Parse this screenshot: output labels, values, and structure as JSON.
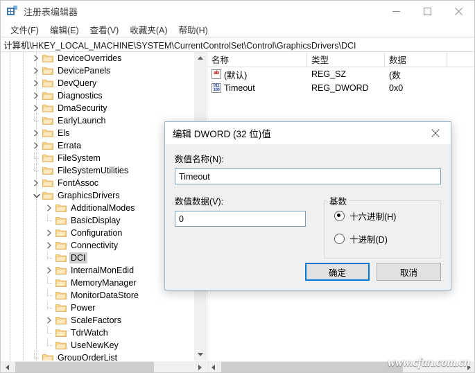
{
  "window": {
    "title": "注册表编辑器",
    "icon": "registry-editor-icon",
    "minimize_label": "最小化",
    "maximize_label": "最大化",
    "close_label": "关闭"
  },
  "menubar": {
    "items": [
      {
        "label": "文件(F)",
        "name": "menu-file"
      },
      {
        "label": "编辑(E)",
        "name": "menu-edit"
      },
      {
        "label": "查看(V)",
        "name": "menu-view"
      },
      {
        "label": "收藏夹(A)",
        "name": "menu-favorites"
      },
      {
        "label": "帮助(H)",
        "name": "menu-help"
      }
    ]
  },
  "address": {
    "path": "计算机\\HKEY_LOCAL_MACHINE\\SYSTEM\\CurrentControlSet\\Control\\GraphicsDrivers\\DCI"
  },
  "tree": {
    "nodes": [
      {
        "label": "DeviceOverrides",
        "indent": 3,
        "expander": "collapsed",
        "selected": false
      },
      {
        "label": "DevicePanels",
        "indent": 3,
        "expander": "collapsed",
        "selected": false
      },
      {
        "label": "DevQuery",
        "indent": 3,
        "expander": "collapsed",
        "selected": false
      },
      {
        "label": "Diagnostics",
        "indent": 3,
        "expander": "collapsed",
        "selected": false
      },
      {
        "label": "DmaSecurity",
        "indent": 3,
        "expander": "collapsed",
        "selected": false
      },
      {
        "label": "EarlyLaunch",
        "indent": 3,
        "expander": "leaf",
        "selected": false
      },
      {
        "label": "Els",
        "indent": 3,
        "expander": "collapsed",
        "selected": false
      },
      {
        "label": "Errata",
        "indent": 3,
        "expander": "collapsed",
        "selected": false
      },
      {
        "label": "FileSystem",
        "indent": 3,
        "expander": "leaf",
        "selected": false
      },
      {
        "label": "FileSystemUtilities",
        "indent": 3,
        "expander": "leaf",
        "selected": false
      },
      {
        "label": "FontAssoc",
        "indent": 3,
        "expander": "collapsed",
        "selected": false
      },
      {
        "label": "GraphicsDrivers",
        "indent": 3,
        "expander": "expanded",
        "selected": false
      },
      {
        "label": "AdditionalModes",
        "indent": 4,
        "expander": "collapsed",
        "selected": false
      },
      {
        "label": "BasicDisplay",
        "indent": 4,
        "expander": "leaf",
        "selected": false
      },
      {
        "label": "Configuration",
        "indent": 4,
        "expander": "collapsed",
        "selected": false
      },
      {
        "label": "Connectivity",
        "indent": 4,
        "expander": "collapsed",
        "selected": false
      },
      {
        "label": "DCI",
        "indent": 4,
        "expander": "leaf",
        "selected": true
      },
      {
        "label": "InternalMonEdid",
        "indent": 4,
        "expander": "collapsed",
        "selected": false
      },
      {
        "label": "MemoryManager",
        "indent": 4,
        "expander": "leaf",
        "selected": false
      },
      {
        "label": "MonitorDataStore",
        "indent": 4,
        "expander": "leaf",
        "selected": false
      },
      {
        "label": "Power",
        "indent": 4,
        "expander": "leaf",
        "selected": false
      },
      {
        "label": "ScaleFactors",
        "indent": 4,
        "expander": "collapsed",
        "selected": false
      },
      {
        "label": "TdrWatch",
        "indent": 4,
        "expander": "leaf",
        "selected": false
      },
      {
        "label": "UseNewKey",
        "indent": 4,
        "expander": "leaf",
        "selected": false
      },
      {
        "label": "GroupOrderList",
        "indent": 3,
        "expander": "leaf",
        "selected": false
      }
    ]
  },
  "list": {
    "columns": [
      {
        "label": "名称",
        "width": 144
      },
      {
        "label": "类型",
        "width": 112
      },
      {
        "label": "数据",
        "width": 90
      }
    ],
    "rows": [
      {
        "icon": "string-value-icon",
        "name": "(默认)",
        "type": "REG_SZ",
        "data": "(数"
      },
      {
        "icon": "dword-value-icon",
        "name": "Timeout",
        "type": "REG_DWORD",
        "data": "0x0"
      }
    ]
  },
  "dialog": {
    "title": "编辑 DWORD (32 位)值",
    "close_label": "关闭",
    "name_label": "数值名称(N):",
    "name_value": "Timeout",
    "data_label": "数值数据(V):",
    "data_value": "0",
    "base_legend": "基数",
    "radios": [
      {
        "label": "十六进制(H)",
        "checked": true,
        "name": "radio-hex"
      },
      {
        "label": "十进制(D)",
        "checked": false,
        "name": "radio-decimal"
      }
    ],
    "ok_label": "确定",
    "cancel_label": "取消"
  },
  "watermark": {
    "text": "www.cfan.com.cn"
  },
  "colors": {
    "accent": "#0078d7",
    "selection": "#cfcfcf",
    "folder": "#f6d38a",
    "chrome": "#f0f0f0"
  }
}
